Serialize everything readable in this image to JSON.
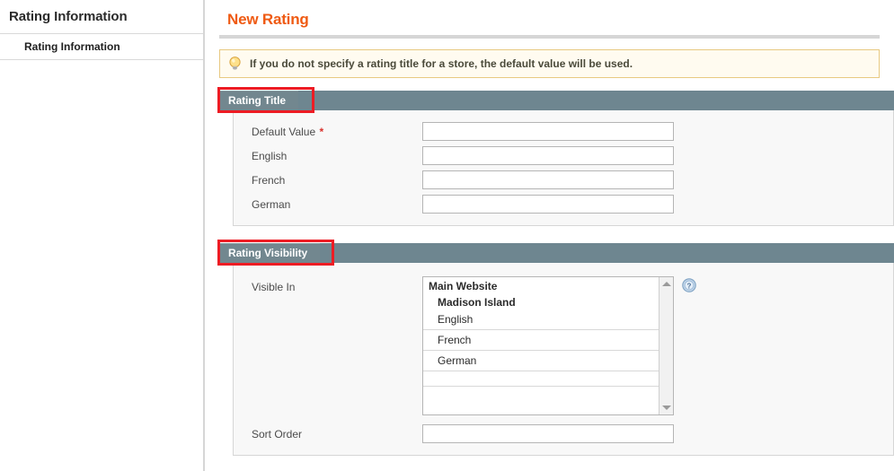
{
  "sidebar": {
    "title": "Rating Information",
    "items": [
      {
        "label": "Rating Information",
        "name": "sidebar-item-rating-information",
        "active": true
      }
    ]
  },
  "page": {
    "title": "New Rating"
  },
  "notice": {
    "icon": "lightbulb-icon",
    "text": "If you do not specify a rating title for a store, the default value will be used."
  },
  "sections": [
    {
      "id": "rating-title",
      "tab_label": "Rating Title",
      "annotated": true,
      "fields": [
        {
          "label": "Default Value",
          "required": true,
          "value": "",
          "placeholder": "",
          "name": "default-value-input"
        },
        {
          "label": "English",
          "required": false,
          "value": "",
          "placeholder": "",
          "name": "english-input"
        },
        {
          "label": "French",
          "required": false,
          "value": "",
          "placeholder": "",
          "name": "french-input"
        },
        {
          "label": "German",
          "required": false,
          "value": "",
          "placeholder": "",
          "name": "german-input"
        }
      ]
    },
    {
      "id": "rating-visibility",
      "tab_label": "Rating Visibility",
      "annotated": true,
      "visible_in": {
        "label": "Visible In",
        "help_icon": "help-circle-icon",
        "options": [
          {
            "text": "Main Website",
            "level": 0,
            "group": true,
            "selected": false
          },
          {
            "text": "Madison Island",
            "level": 1,
            "group": true,
            "selected": false
          },
          {
            "text": "English",
            "level": 2,
            "group": false,
            "selected": false
          },
          {
            "text": "French",
            "level": 2,
            "group": false,
            "selected": false
          },
          {
            "text": "German",
            "level": 2,
            "group": false,
            "selected": false
          }
        ]
      },
      "sort_order": {
        "label": "Sort Order",
        "value": "",
        "placeholder": "",
        "name": "sort-order-input"
      }
    }
  ],
  "colors": {
    "accent_orange": "#ef5a12",
    "section_header": "#6e8690",
    "section_tab": "#72878f",
    "annotation_red": "#ed1c24",
    "notice_bg": "#fffbf0",
    "notice_border": "#e8c981",
    "required_star": "#d9332e"
  }
}
